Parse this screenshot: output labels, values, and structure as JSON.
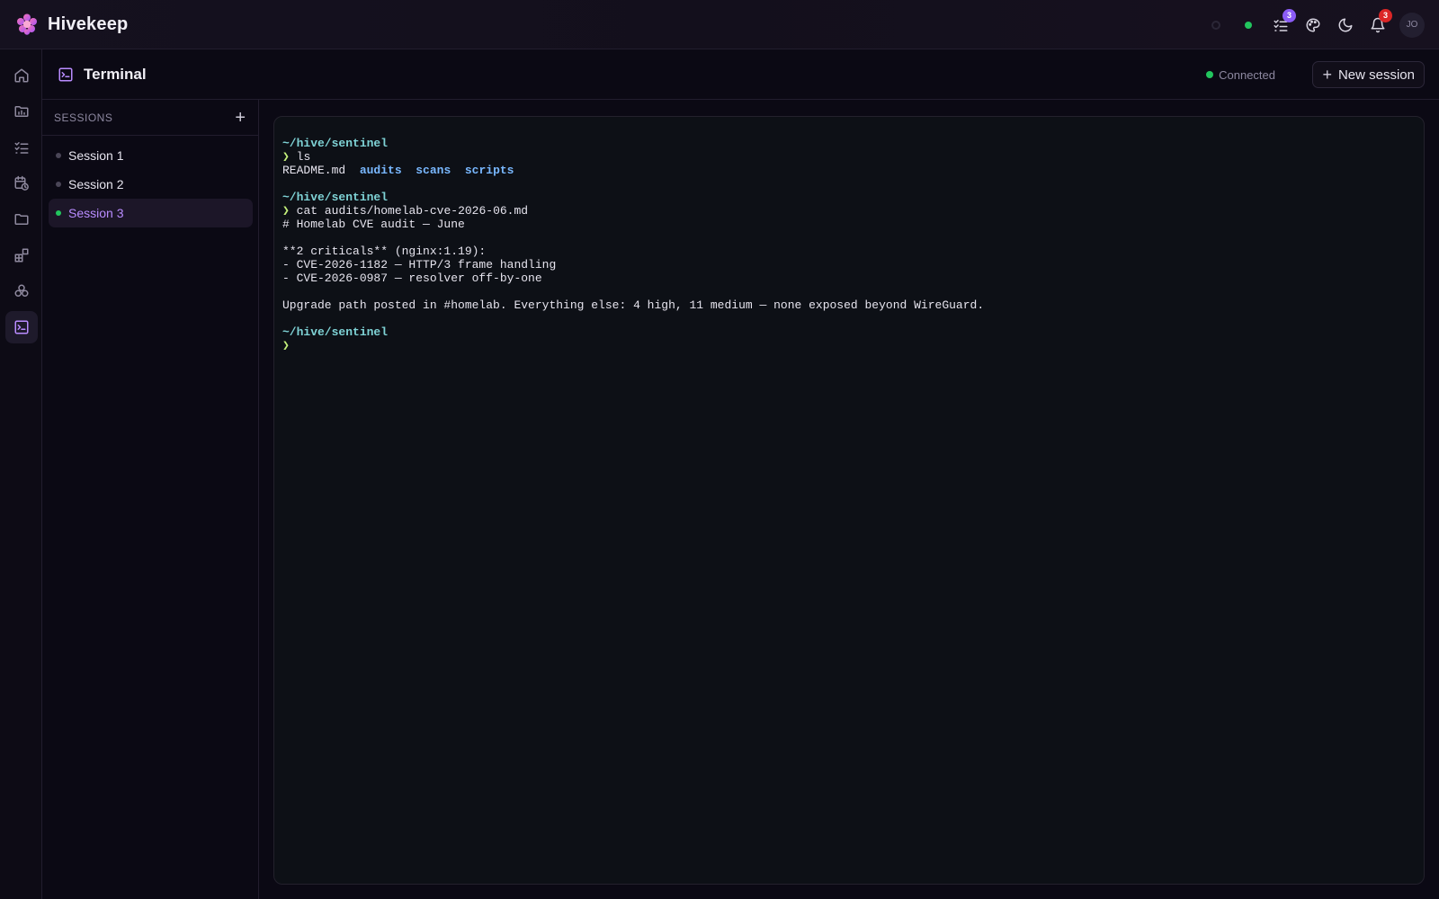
{
  "app": {
    "name": "Hivekeep"
  },
  "topbar": {
    "tasks_badge": "3",
    "notifications_badge": "3",
    "avatar_initials": "JO"
  },
  "page": {
    "title": "Terminal",
    "status": "Connected",
    "new_session_label": "New session"
  },
  "sessions": {
    "header": "SESSIONS",
    "items": [
      {
        "label": "Session 1",
        "active": false
      },
      {
        "label": "Session 2",
        "active": false
      },
      {
        "label": "Session 3",
        "active": true
      }
    ]
  },
  "terminal": {
    "block1": {
      "path": "~/hive/sentinel",
      "prompt": "❯",
      "command": "ls",
      "out_file": "README.md",
      "out_dirs": [
        "audits",
        "scans",
        "scripts"
      ]
    },
    "block2": {
      "path": "~/hive/sentinel",
      "prompt": "❯",
      "command": "cat audits/homelab-cve-2026-06.md",
      "lines": [
        "# Homelab CVE audit — June",
        "",
        "**2 criticals** (nginx:1.19):",
        "- CVE-2026-1182 — HTTP/3 frame handling",
        "- CVE-2026-0987 — resolver off-by-one",
        "",
        "Upgrade path posted in #homelab. Everything else: 4 high, 11 medium — none exposed beyond WireGuard."
      ]
    },
    "block3": {
      "path": "~/hive/sentinel",
      "prompt": "❯"
    }
  },
  "colors": {
    "accent": "#b98cff",
    "status_green": "#22c55e",
    "terminal_path": "#7fd3d6",
    "terminal_prompt": "#c4f07a",
    "terminal_dir": "#79b8ff"
  },
  "icons": {
    "rail": [
      "home-icon",
      "projects-icon",
      "tasks-icon",
      "schedule-icon",
      "files-icon",
      "apps-icon",
      "integrations-icon",
      "terminal-icon"
    ],
    "topbar": [
      "tasks-icon",
      "palette-icon",
      "moon-icon",
      "bell-icon"
    ]
  }
}
